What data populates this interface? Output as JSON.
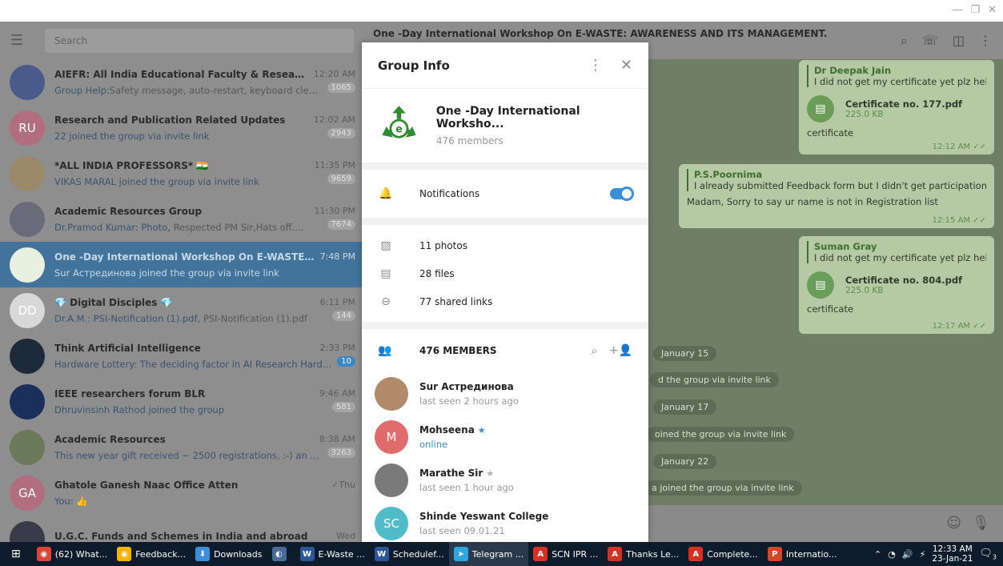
{
  "window": {
    "minimize": "—",
    "restore": "❐",
    "close": "✕"
  },
  "search": {
    "placeholder": "Search"
  },
  "chats": [
    {
      "name": "AIEFR: All India Educational Faculty & Research Up...",
      "time": "12:20 AM",
      "sender": "Group Help:",
      "message": "Safety message, auto-restart, keyboard cleanin...",
      "badge": "1065",
      "avatar_color": "#4a5a8a"
    },
    {
      "name": "Research and Publication Related Updates",
      "time": "12:02 AM",
      "sender": "",
      "message": "22 joined the group via invite link",
      "badge": "2943",
      "avatar_text": "RU",
      "avatar_color": "#b06e7e"
    },
    {
      "name": "*ALL INDIA PROFESSORS* 🇮🇳",
      "time": "11:35 PM",
      "sender": "",
      "message": "VIKAS MARAL joined the group via invite link",
      "badge": "9659",
      "avatar_color": "#9a8a6a"
    },
    {
      "name": "Academic Resources Group",
      "time": "11:30 PM",
      "sender": "Dr.Pramod Kumar: Photo,",
      "message": " Respected PM Sir,Hats off....",
      "badge": "7674",
      "avatar_color": "#6a6a7a"
    },
    {
      "name": "One -Day International Workshop On E-WASTE: AWA...",
      "time": "7:48 PM",
      "sender": "",
      "message": "Sur Астрединова joined the group via invite link",
      "badge": "",
      "avatar_color": "#e8f0e0"
    },
    {
      "name": "💎 Digital Disciples 💎",
      "time": "6:11 PM",
      "sender": "Dr.A.M.: PSI-Notification (1).pdf,",
      "message": " PSI-Notification (1).pdf",
      "badge": "144",
      "avatar_text": "DD",
      "avatar_color": "#d8d8d8"
    },
    {
      "name": "Think Artificial Intelligence",
      "time": "2:33 PM",
      "sender": "",
      "message": "Hardware Lottery: The deciding factor in AI Research Hardwar...",
      "badge": "10",
      "avatar_color": "#1d2a3a"
    },
    {
      "name": "IEEE researchers forum BLR",
      "time": "9:46 AM",
      "sender": "",
      "message": "Dhruvinsinh Rathod joined the group",
      "badge": "581",
      "avatar_color": "#1a2f5a"
    },
    {
      "name": "Academic Resources",
      "time": "8:38 AM",
      "sender": "",
      "message": "This new year gift received ~ 2500 registrations, :-) an absolut...",
      "badge": "3263",
      "avatar_color": "#6a7a5a"
    },
    {
      "name": "Ghatole Ganesh Naac Office Atten",
      "time": "✓Thu",
      "sender": "You: 👍",
      "message": "",
      "badge": "",
      "avatar_text": "GA",
      "avatar_color": "#b06e7e"
    },
    {
      "name": "U.G.C. Funds and Schemes in India and abroad",
      "time": "Wed",
      "sender": "",
      "message": "",
      "badge": "",
      "avatar_color": "#3a3a4a"
    }
  ],
  "chat": {
    "title": "One -Day International Workshop On E-WASTE: AWARENESS AND ITS MANAGEMENT.",
    "messages": [
      {
        "author": "Dr Deepak Jain",
        "quote": "I did not get my certificate yet plz hel...",
        "file": "Certificate no. 177.pdf",
        "size": "225.0 KB",
        "text": "certificate",
        "time": "12:12 AM ✓✓"
      },
      {
        "author": "P.S.Poornima",
        "quote": "I already submitted Feedback form but I didn't get  participation ...",
        "text": "Madam, Sorry to say ur name is not in Registration list",
        "time": "12:15 AM ✓✓"
      },
      {
        "author": "Suman Gray",
        "quote": "I did not get my certificate yet plz hel...",
        "file": "Certificate no. 804.pdf",
        "size": "225.0 KB",
        "text": "certificate",
        "time": "12:17 AM ✓✓"
      }
    ],
    "service": [
      "January 15",
      "d the group via invite link",
      "January 17",
      "oined the group via invite link",
      "January 22",
      "a joined the group via invite link"
    ]
  },
  "group_info": {
    "title": "Group Info",
    "name": "One -Day International Worksho...",
    "members_count": "476 members",
    "notifications_label": "Notifications",
    "notifications_on": true,
    "photos": "11 photos",
    "files": "28 files",
    "links": "77 shared links",
    "members_title": "476 MEMBERS",
    "members": [
      {
        "name": "Sur Астрединова",
        "status": "last seen 2 hours ago",
        "avatar_color": "#b08a6a"
      },
      {
        "name": "Mohseena",
        "status": "online",
        "star": "★",
        "avatar_text": "M",
        "avatar_color": "#e06b6b"
      },
      {
        "name": "Marathe Sir",
        "status": "last seen 1 hour ago",
        "star": "★",
        "avatar_color": "#7a7a7a"
      },
      {
        "name": "Shinde Yeswant College",
        "status": "last seen 09.01.21",
        "avatar_text": "SC",
        "avatar_color": "#4fbcc8"
      }
    ]
  },
  "taskbar": {
    "items": [
      {
        "label": "(62) What...",
        "color": "#db4437",
        "glyph": "◉"
      },
      {
        "label": "Feedback...",
        "color": "#f4b400",
        "glyph": "◉"
      },
      {
        "label": "Downloads",
        "color": "#3a8fd9",
        "glyph": "⬇"
      },
      {
        "label": "",
        "color": "#4a6a9a",
        "glyph": "◐"
      },
      {
        "label": "E-Waste ...",
        "color": "#2b579a",
        "glyph": "W"
      },
      {
        "label": "Schedulef...",
        "color": "#2b579a",
        "glyph": "W"
      },
      {
        "label": "Telegram ...",
        "color": "#2ca5e0",
        "glyph": "➤"
      },
      {
        "label": "SCN IPR ...",
        "color": "#d93025",
        "glyph": "A"
      },
      {
        "label": "Thanks Le...",
        "color": "#d93025",
        "glyph": "A"
      },
      {
        "label": "Complete...",
        "color": "#d93025",
        "glyph": "A"
      },
      {
        "label": "Internatio...",
        "color": "#d24726",
        "glyph": "P"
      }
    ],
    "time": "12:33 AM",
    "date": "23-Jan-21",
    "notif": "3"
  }
}
